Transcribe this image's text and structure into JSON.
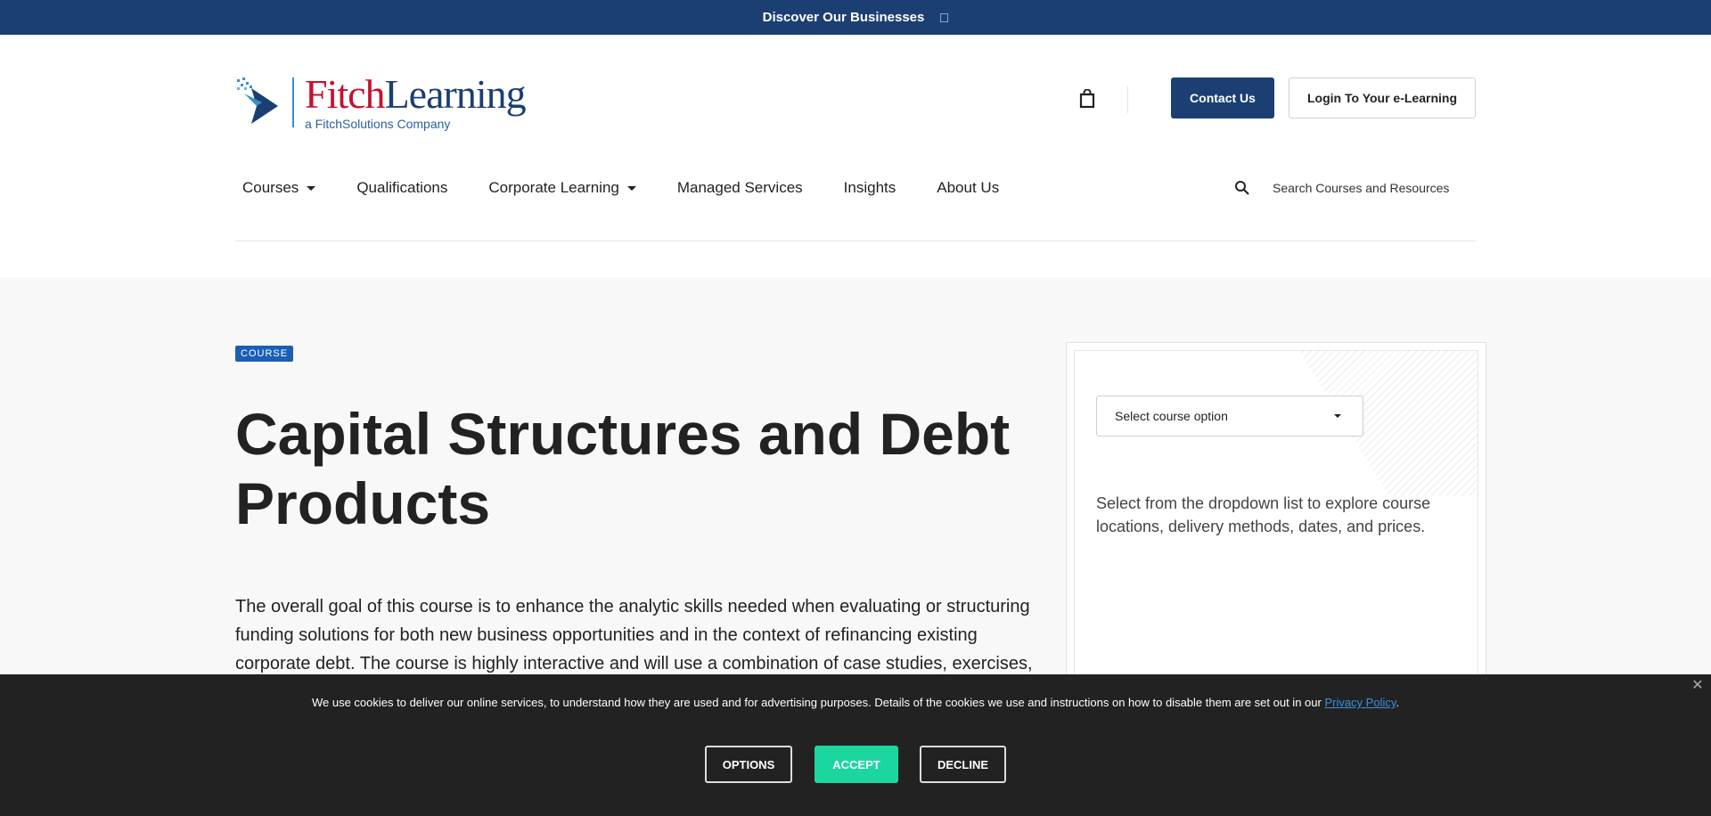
{
  "topbar": {
    "label": "Discover Our Businesses"
  },
  "logo": {
    "brand_first": "Fitch",
    "brand_second": "Learning",
    "tagline": "a FitchSolutions Company"
  },
  "header": {
    "contact_label": "Contact Us",
    "login_label": "Login To Your e-Learning"
  },
  "nav": {
    "items": [
      {
        "label": "Courses"
      },
      {
        "label": "Qualifications"
      },
      {
        "label": "Corporate Learning"
      },
      {
        "label": "Managed Services"
      },
      {
        "label": "Insights"
      },
      {
        "label": "About Us"
      }
    ]
  },
  "search": {
    "placeholder": "Search Courses and Resources"
  },
  "course": {
    "badge": "COURSE",
    "title": "Capital Structures and Debt Products",
    "description": "The overall goal of this course is to enhance the analytic skills needed when evaluating or structuring funding solutions for both new business opportunities and in the context of refinancing existing corporate debt. The course is highly interactive and will use a combination of case studies, exercises, and examples"
  },
  "panel": {
    "select_label": "Select course option",
    "help_text": "Select from the dropdown list to explore course locations, delivery methods, dates, and prices."
  },
  "cookie": {
    "text": "We use cookies to deliver our online services, to understand how they are used and for advertising purposes. Details of the cookies we use and instructions on how to disable them are set out in our ",
    "link_text": "Privacy Policy",
    "suffix": ".",
    "options_label": "OPTIONS",
    "accept_label": "ACCEPT",
    "decline_label": "DECLINE",
    "close_glyph": "✕"
  },
  "colors": {
    "brand_navy": "#1b3f72",
    "brand_red": "#c8102e",
    "badge_blue": "#1b5eb5",
    "accept_green": "#1cd6a0"
  }
}
